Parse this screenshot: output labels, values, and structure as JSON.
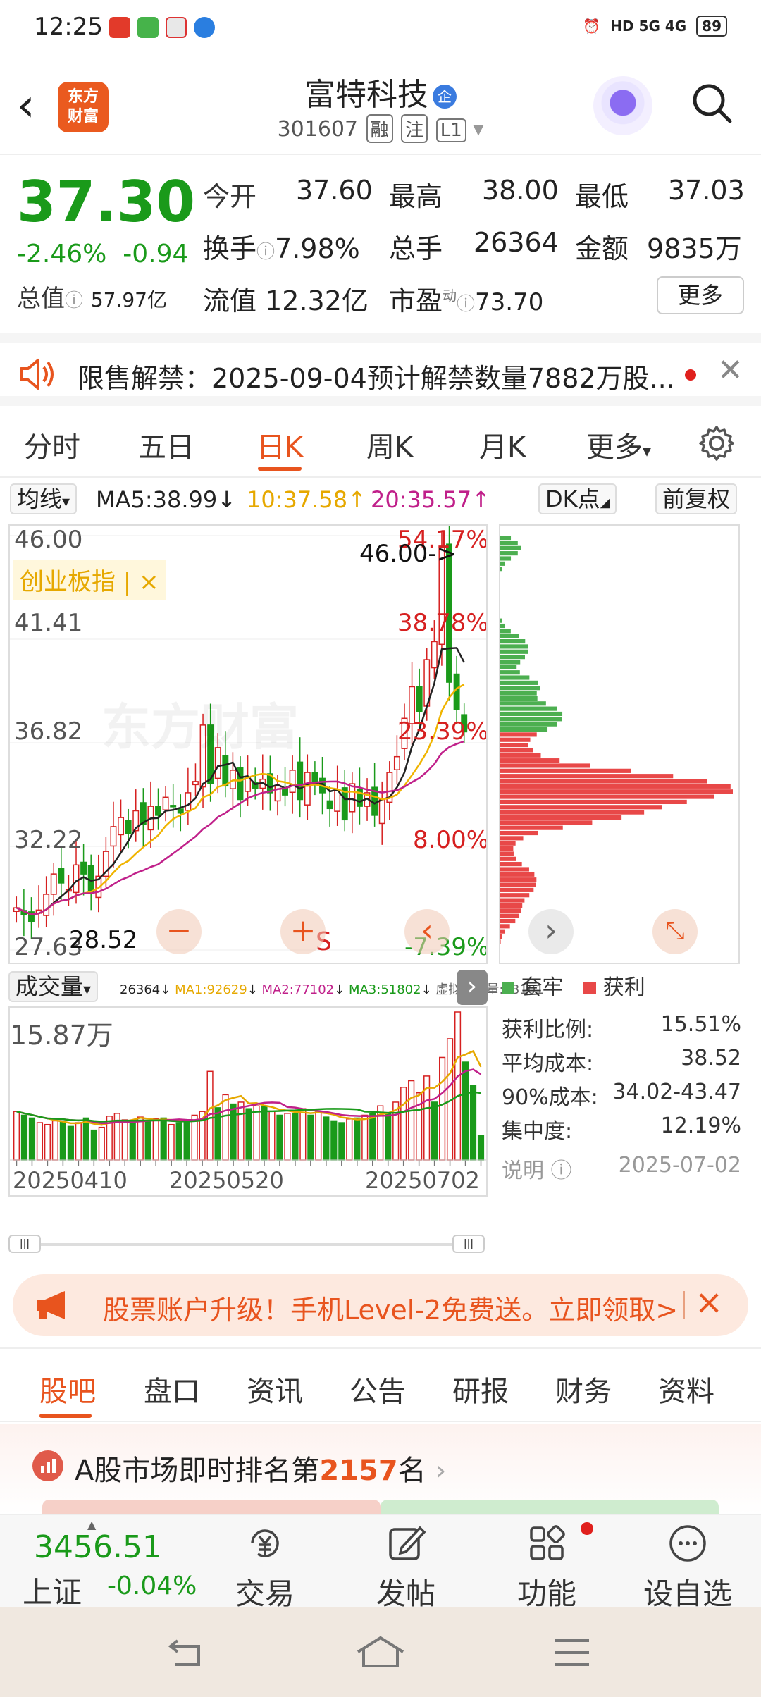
{
  "status_bar": {
    "time": "12:25",
    "network": "HD 5G 4G",
    "battery": "89"
  },
  "header": {
    "back": "‹",
    "logo_line1": "东方",
    "logo_line2": "财富",
    "stock_name": "富特科技",
    "name_badge": "企",
    "code": "301607",
    "tags": [
      "融",
      "注",
      "L1"
    ]
  },
  "quote": {
    "price": "37.30",
    "change_pct": "-2.46%",
    "change": "-0.94",
    "open_label": "今开",
    "open": "37.60",
    "high_label": "最高",
    "high": "38.00",
    "low_label": "最低",
    "low": "37.03",
    "turnover_label": "换手",
    "turnover": "7.98%",
    "volume_label": "总手",
    "volume": "26364",
    "amount_label": "金额",
    "amount": "9835万",
    "mktcap_label": "总值",
    "mktcap": "57.97亿",
    "float_label": "流值",
    "float": "12.32亿",
    "pe_label": "市盈",
    "pe_sup": "动",
    "pe": "73.70",
    "more_button": "更多"
  },
  "notice": {
    "text": "限售解禁：2025-09-04预计解禁数量7882万股..."
  },
  "kline_tabs": {
    "items": [
      "分时",
      "五日",
      "日K",
      "周K",
      "月K",
      "更多"
    ],
    "active": "日K"
  },
  "ma_bar": {
    "ma_button": "均线",
    "ma5": "MA5:38.99",
    "ma10": "10:37.58",
    "ma20": "20:35.57",
    "dk_button": "DK点",
    "adjust_button": "前复权"
  },
  "price_chart": {
    "y_labels": [
      "46.00",
      "41.41",
      "36.82",
      "32.22",
      "27.63"
    ],
    "pct_labels": [
      "54.17%",
      "38.78%",
      "23.39%",
      "8.00%",
      "-7.39%"
    ],
    "index_overlay": "创业板指",
    "index_overlay_close": "×",
    "high_annotation": "46.00->",
    "low_annotation": "28.52",
    "sell_marker": "S",
    "watermark": "东方财富"
  },
  "volume_bar": {
    "label": "成交量",
    "vol": "26364",
    "ma1": "MA1:92629",
    "ma2": "MA2:77102",
    "ma3": "MA3:51802",
    "virtual": "虚拟成交量:53101"
  },
  "volume_chart": {
    "max_label": "15.87万",
    "dates": [
      "20250410",
      "20250520",
      "20250702"
    ]
  },
  "profile_stats": {
    "legend_trapped": "套牢",
    "legend_profit": "获利",
    "profit_ratio_label": "获利比例:",
    "profit_ratio": "15.51%",
    "avg_cost_label": "平均成本:",
    "avg_cost": "38.52",
    "cost90_label": "90%成本:",
    "cost90": "34.02-43.47",
    "concentration_label": "集中度:",
    "concentration": "12.19%",
    "note_label": "说明",
    "note_date": "2025-07-02"
  },
  "promo": {
    "text": "股票账户升级！手机Level-2免费送。立即领取>",
    "close": "×"
  },
  "sub_tabs": {
    "items": [
      "股吧",
      "盘口",
      "资讯",
      "公告",
      "研报",
      "财务",
      "资料"
    ],
    "active": "股吧"
  },
  "rank": {
    "prefix": "A股市场即时排名第",
    "number": "2157",
    "suffix": "名"
  },
  "bottom_nav": {
    "index_value": "3456.51",
    "index_name": "上证",
    "index_change": "-0.04%",
    "items": [
      "交易",
      "发帖",
      "功能",
      "设自选"
    ]
  },
  "colors": {
    "accent": "#e8541e",
    "up": "#d62020",
    "down": "#1a9a1a",
    "ma5": "#222222",
    "ma10": "#f0b400",
    "ma20": "#c0208a"
  },
  "chart_data": [
    {
      "type": "candlestick",
      "title": "日K",
      "ylim": [
        27.63,
        46.0
      ],
      "y_ticks": [
        46.0,
        41.41,
        36.82,
        32.22,
        27.63
      ],
      "x_ticks": [
        "20250410",
        "20250520",
        "20250702"
      ],
      "series": [
        {
          "name": "MA5",
          "value": 38.99
        },
        {
          "name": "10",
          "value": 37.58
        },
        {
          "name": "20",
          "value": 35.57
        }
      ],
      "close_approx": [
        29.5,
        29.2,
        28.9,
        29.4,
        30.1,
        31.0,
        30.6,
        30.3,
        31.4,
        31.0,
        30.2,
        30.9,
        32.0,
        33.1,
        33.5,
        32.8,
        33.8,
        33.2,
        34.0,
        33.6,
        34.4,
        34.0,
        33.7,
        34.6,
        35.1,
        37.6,
        35.0,
        36.6,
        34.9,
        35.6,
        34.3,
        35.3,
        34.8,
        35.2,
        34.6,
        34.9,
        34.5,
        35.6,
        34.3,
        35.5,
        35.0,
        34.6,
        33.9,
        34.7,
        33.4,
        35.0,
        34.0,
        34.6,
        33.6,
        34.3,
        35.5,
        36.2,
        37.9,
        39.3,
        38.2,
        40.5,
        41.3,
        45.5,
        39.5,
        38.3,
        37.3
      ]
    },
    {
      "type": "bar",
      "title": "成交量",
      "ylim": [
        0,
        158700
      ],
      "legend": [
        "MA1:92629",
        "MA2:77102",
        "MA3:51802"
      ],
      "values": [
        52000,
        48000,
        45000,
        40000,
        38000,
        42000,
        41000,
        36000,
        40000,
        45000,
        32000,
        35000,
        47000,
        50000,
        43000,
        40000,
        46000,
        42000,
        44000,
        45000,
        38000,
        40000,
        42000,
        48000,
        52000,
        95000,
        56000,
        70000,
        60000,
        62000,
        55000,
        58000,
        57000,
        52000,
        48000,
        50000,
        50000,
        55000,
        48000,
        52000,
        46000,
        42000,
        40000,
        44000,
        45000,
        48000,
        50000,
        58000,
        50000,
        62000,
        78000,
        85000,
        72000,
        90000,
        62000,
        110000,
        130000,
        158700,
        105000,
        80000,
        26364
      ]
    }
  ]
}
